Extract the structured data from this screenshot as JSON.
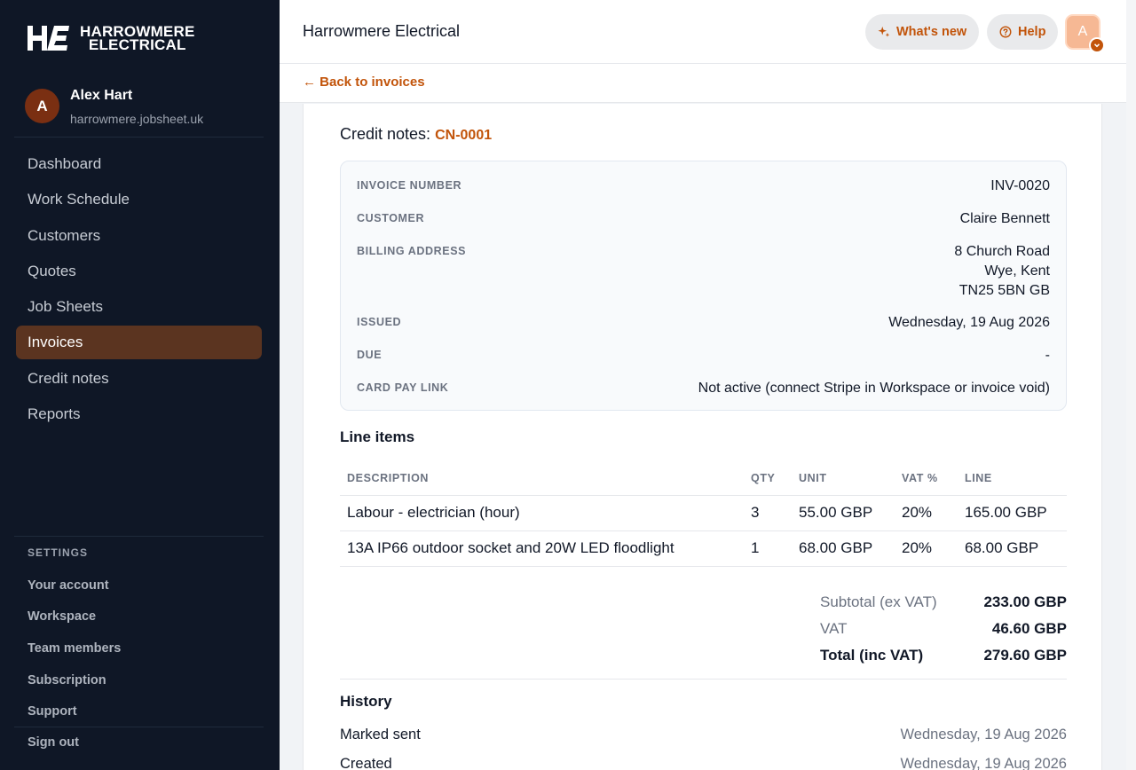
{
  "sidebar": {
    "logo_line1": "HARROWMERE",
    "logo_line2": "ELECTRICAL",
    "user": {
      "initial": "A",
      "name": "Alex Hart",
      "domain": "harrowmere.jobsheet.uk"
    },
    "nav": [
      {
        "label": "Dashboard",
        "active": false
      },
      {
        "label": "Work Schedule",
        "active": false
      },
      {
        "label": "Customers",
        "active": false
      },
      {
        "label": "Quotes",
        "active": false
      },
      {
        "label": "Job Sheets",
        "active": false
      },
      {
        "label": "Invoices",
        "active": true
      },
      {
        "label": "Credit notes",
        "active": false
      },
      {
        "label": "Reports",
        "active": false
      }
    ],
    "settings_label": "SETTINGS",
    "settings": [
      "Your account",
      "Workspace",
      "Team members",
      "Subscription",
      "Support"
    ],
    "signout": "Sign out"
  },
  "topbar": {
    "title": "Harrowmere Electrical",
    "whats_new": "What's new",
    "help": "Help",
    "avatar_initial": "A"
  },
  "subbar": {
    "back": "← Back to invoices"
  },
  "invoice": {
    "credit_label": "Credit notes:",
    "credit_note": "CN-0001",
    "details": [
      {
        "label": "INVOICE NUMBER",
        "value": "INV-0020"
      },
      {
        "label": "CUSTOMER",
        "value": "Claire Bennett"
      },
      {
        "label": "BILLING ADDRESS",
        "value": [
          "8 Church Road",
          "Wye, Kent",
          "TN25 5BN GB"
        ]
      },
      {
        "label": "ISSUED",
        "value": "Wednesday, 19 Aug 2026"
      },
      {
        "label": "DUE",
        "value": "-"
      },
      {
        "label": "CARD PAY LINK",
        "value": "Not active (connect Stripe in Workspace or invoice void)"
      }
    ],
    "line_items_title": "Line items",
    "columns": [
      "DESCRIPTION",
      "QTY",
      "UNIT",
      "VAT %",
      "LINE"
    ],
    "rows": [
      [
        "Labour - electrician (hour)",
        "3",
        "55.00 GBP",
        "20%",
        "165.00 GBP"
      ],
      [
        "13A IP66 outdoor socket and 20W LED floodlight",
        "1",
        "68.00 GBP",
        "20%",
        "68.00 GBP"
      ]
    ],
    "totals": [
      {
        "label": "Subtotal (ex VAT)",
        "value": "233.00 GBP"
      },
      {
        "label": "VAT",
        "value": "46.60 GBP"
      },
      {
        "label": "Total (inc VAT)",
        "value": "279.60 GBP"
      }
    ],
    "history_title": "History",
    "history": [
      {
        "event": "Marked sent",
        "date": "Wednesday, 19 Aug 2026"
      },
      {
        "event": "Created",
        "date": "Wednesday, 19 Aug 2026"
      }
    ]
  }
}
